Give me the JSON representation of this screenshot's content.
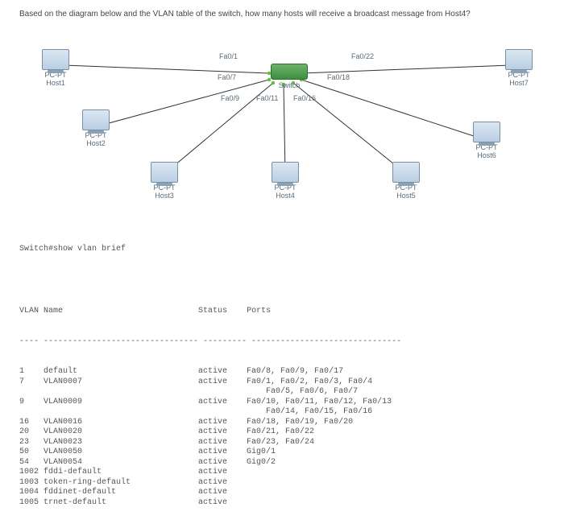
{
  "question": "Based on the diagram below and the VLAN table of the switch, how many hosts will receive a broadcast message from Host4?",
  "nodes": {
    "host1": {
      "type": "PC-PT",
      "label": "Host1"
    },
    "host2": {
      "type": "PC-PT",
      "label": "Host2"
    },
    "host3": {
      "type": "PC-PT",
      "label": "Host3"
    },
    "host4": {
      "type": "PC-PT",
      "label": "Host4"
    },
    "host5": {
      "type": "PC-PT",
      "label": "Host5"
    },
    "host6": {
      "type": "PC-PT",
      "label": "Host6"
    },
    "host7": {
      "type": "PC-PT",
      "label": "Host7"
    },
    "switch": {
      "type": "2960-24TT",
      "label": "Switch"
    }
  },
  "ports": {
    "fa01": "Fa0/1",
    "fa07": "Fa0/7",
    "fa09": "Fa0/9",
    "fa011": "Fa0/11",
    "fa016": "Fa0/16",
    "fa018": "Fa0/18",
    "fa022": "Fa0/22"
  },
  "cli": {
    "command": "Switch#show vlan brief",
    "headers": {
      "vlan": "VLAN Name",
      "status": "Status",
      "ports": "Ports"
    },
    "rows": [
      {
        "vlan": "1",
        "name": "default",
        "status": "active",
        "ports": "Fa0/8, Fa0/9, Fa0/17"
      },
      {
        "vlan": "7",
        "name": "VLAN0007",
        "status": "active",
        "ports": "Fa0/1, Fa0/2, Fa0/3, Fa0/4\n                                                   Fa0/5, Fa0/6, Fa0/7"
      },
      {
        "vlan": "9",
        "name": "VLAN0009",
        "status": "active",
        "ports": "Fa0/10, Fa0/11, Fa0/12, Fa0/13\n                                                   Fa0/14, Fa0/15, Fa0/16"
      },
      {
        "vlan": "16",
        "name": "VLAN0016",
        "status": "active",
        "ports": "Fa0/18, Fa0/19, Fa0/20"
      },
      {
        "vlan": "20",
        "name": "VLAN0020",
        "status": "active",
        "ports": "Fa0/21, Fa0/22"
      },
      {
        "vlan": "23",
        "name": "VLAN0023",
        "status": "active",
        "ports": "Fa0/23, Fa0/24"
      },
      {
        "vlan": "50",
        "name": "VLAN0050",
        "status": "active",
        "ports": "Gig0/1"
      },
      {
        "vlan": "54",
        "name": "VLAN0054",
        "status": "active",
        "ports": "Gig0/2"
      },
      {
        "vlan": "1002",
        "name": "fddi-default",
        "status": "active",
        "ports": ""
      },
      {
        "vlan": "1003",
        "name": "token-ring-default",
        "status": "active",
        "ports": ""
      },
      {
        "vlan": "1004",
        "name": "fddinet-default",
        "status": "active",
        "ports": ""
      },
      {
        "vlan": "1005",
        "name": "trnet-default",
        "status": "active",
        "ports": ""
      }
    ]
  }
}
